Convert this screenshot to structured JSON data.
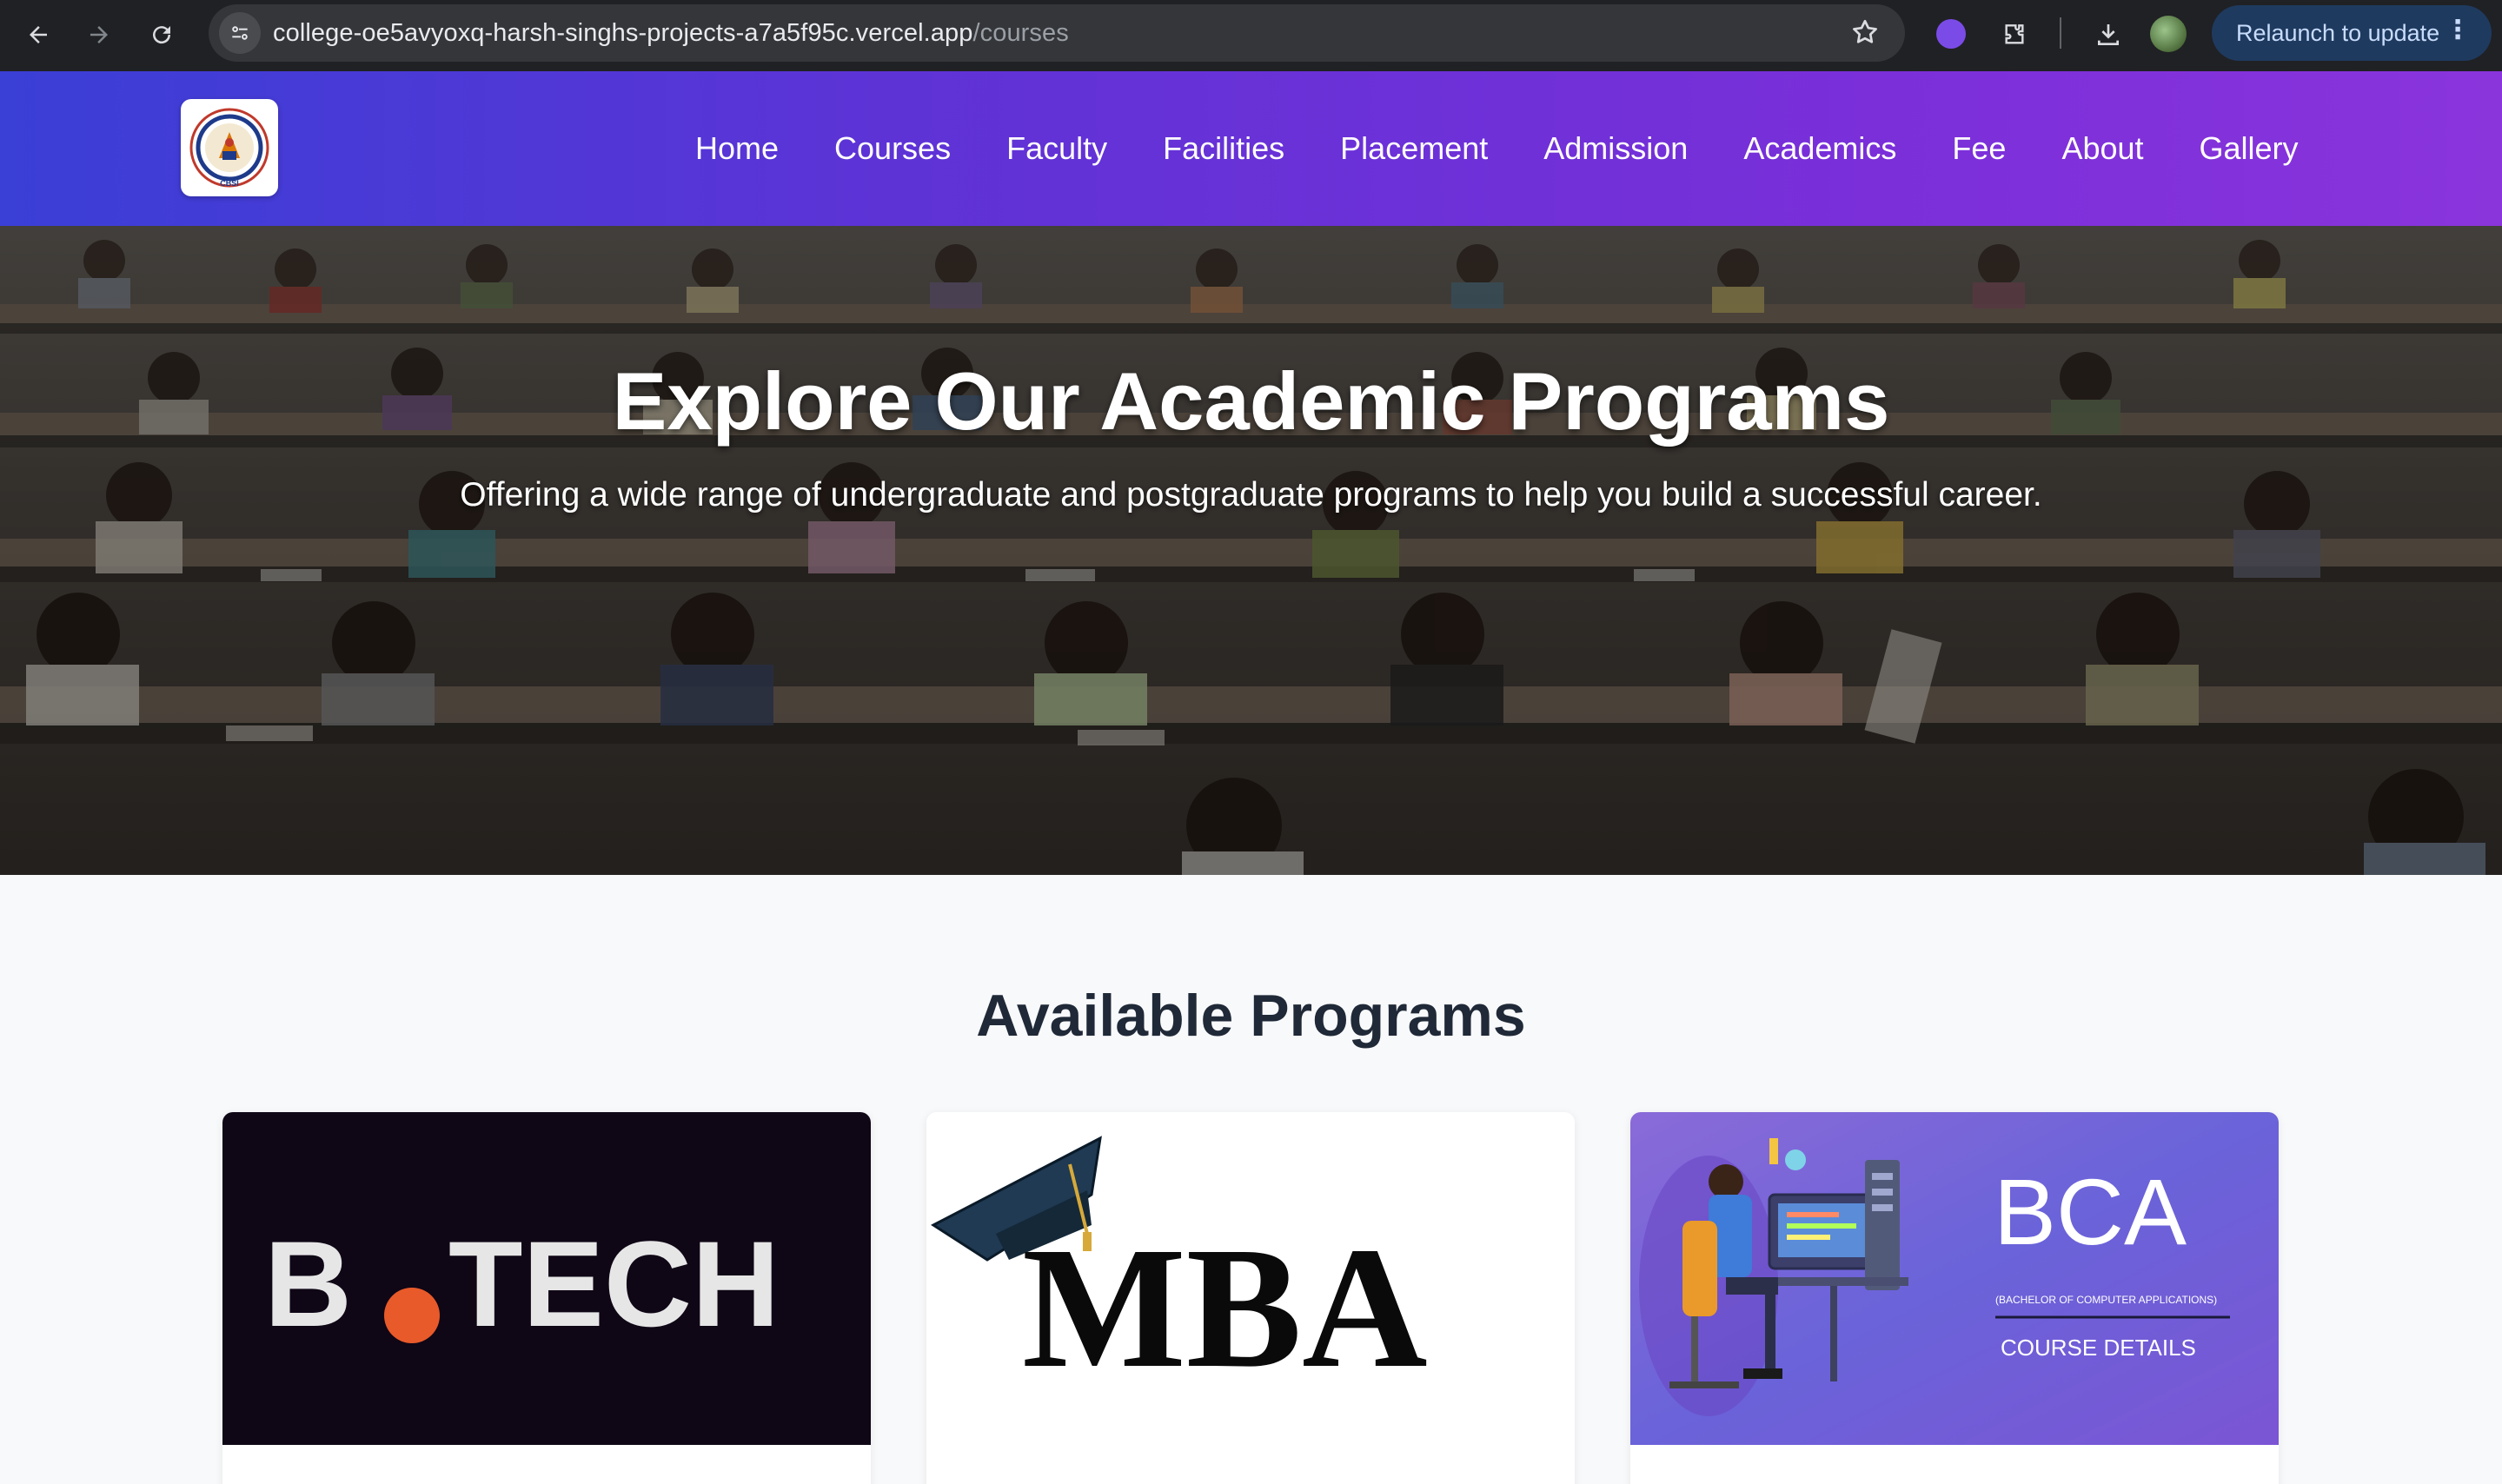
{
  "browser": {
    "url_host": "college-oe5avyoxq-harsh-singhs-projects-a7a5f95c.vercel.app",
    "url_path": "/courses",
    "relaunch_label": "Relaunch to update"
  },
  "site": {
    "logo_text": "CBSI",
    "nav": [
      "Home",
      "Courses",
      "Faculty",
      "Facilities",
      "Placement",
      "Admission",
      "Academics",
      "Fee",
      "About",
      "Gallery"
    ]
  },
  "hero": {
    "title": "Explore Our Academic Programs",
    "subtitle": "Offering a wide range of undergraduate and postgraduate programs to help you build a successful career."
  },
  "programs": {
    "heading": "Available Programs",
    "cards": [
      {
        "image_text_1": "B",
        "image_text_2": "TECH",
        "brand_color": "#e85a2a"
      },
      {
        "image_text": "MBA"
      },
      {
        "image_title": "BCA",
        "image_subtitle": "(BACHELOR OF COMPUTER APPLICATIONS)",
        "image_caption": "COURSE DETAILS"
      }
    ]
  },
  "colors": {
    "header_start": "#3a3fd6",
    "header_end": "#8a34dc",
    "heading_text": "#1f2937"
  }
}
